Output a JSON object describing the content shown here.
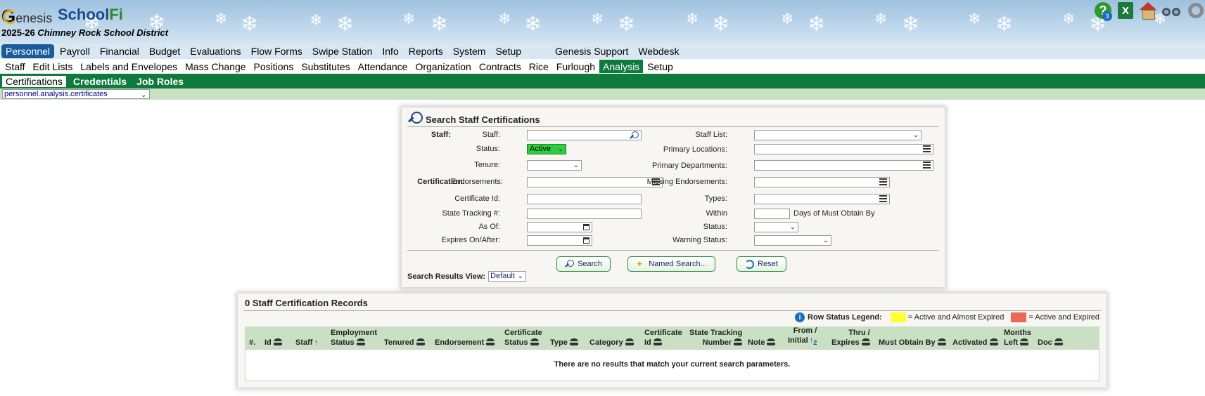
{
  "header": {
    "logo_genesis": "enesis",
    "logo_genesis_g": "G",
    "logo_school": "School",
    "logo_fi": "Fi",
    "district_year": "2025-26",
    "district_name": "Chimney Rock School District",
    "help_badge": "3",
    "help_glyph": "?",
    "excel_glyph": "X"
  },
  "menu1": {
    "items": [
      "Personnel",
      "Payroll",
      "Financial",
      "Budget",
      "Evaluations",
      "Flow Forms",
      "Swipe Station",
      "Info",
      "Reports",
      "System",
      "Setup"
    ],
    "items_right": [
      "Genesis Support",
      "Webdesk"
    ],
    "active": "Personnel"
  },
  "menu2": {
    "items": [
      "Staff",
      "Edit Lists",
      "Labels and Envelopes",
      "Mass Change",
      "Positions",
      "Substitutes",
      "Attendance",
      "Organization",
      "Contracts",
      "Rice",
      "Furlough",
      "Analysis",
      "Setup"
    ],
    "active": "Analysis"
  },
  "menu3": {
    "items": [
      "Certifications",
      "Credentials",
      "Job Roles"
    ],
    "active": "Certifications"
  },
  "path_select": {
    "value": "personnel.analysis.certificates"
  },
  "search": {
    "title": "Search Staff Certifications",
    "section_staff": "Staff:",
    "section_cert": "Certification:",
    "labels": {
      "staff": "Staff:",
      "status": "Status:",
      "tenure": "Tenure:",
      "endorsements": "Endorsements:",
      "certificate_id": "Certificate Id:",
      "state_tracking": "State Tracking #:",
      "as_of": "As Of:",
      "expires": "Expires On/After:",
      "staff_list": "Staff List:",
      "primary_locations": "Primary Locations:",
      "primary_departments": "Primary Departments:",
      "missing_endorsements": "Missing Endorsements:",
      "types": "Types:",
      "within": "Within",
      "days_suffix": "Days of Must Obtain By",
      "cert_status": "Status:",
      "warning_status": "Warning Status:"
    },
    "values": {
      "status": "Active"
    },
    "buttons": {
      "search": "Search",
      "named_search": "Named Search...",
      "reset": "Reset"
    },
    "results_view_label": "Search Results View:",
    "results_view_value": "Default"
  },
  "results": {
    "title": "0 Staff Certification Records",
    "legend_title": "Row Status Legend:",
    "legend_yellow": "= Active and Almost Expired",
    "legend_red": "= Active and Expired",
    "legend_colors": {
      "yellow": "#ffff33",
      "red": "#ee6655"
    },
    "columns": {
      "num": "#.",
      "id": "Id",
      "staff": "Staff",
      "emp_status_1": "Employment",
      "emp_status_2": "Status",
      "tenured": "Tenured",
      "endorsement": "Endorsement",
      "cert_status_1": "Certificate",
      "cert_status_2": "Status",
      "type": "Type",
      "category": "Category",
      "cert_id_1": "Certificate",
      "cert_id_2": "Id",
      "state_1": "State Tracking",
      "state_2": "Number",
      "note": "Note",
      "from_1": "From /",
      "from_2": "Initial",
      "from_sort": "2",
      "thru_1": "Thru /",
      "thru_2": "Expires",
      "must_obtain": "Must Obtain By",
      "activated": "Activated",
      "months_1": "Months",
      "months_2": "Left",
      "doc": "Doc"
    },
    "empty_message": "There are no results that match your current search parameters."
  }
}
